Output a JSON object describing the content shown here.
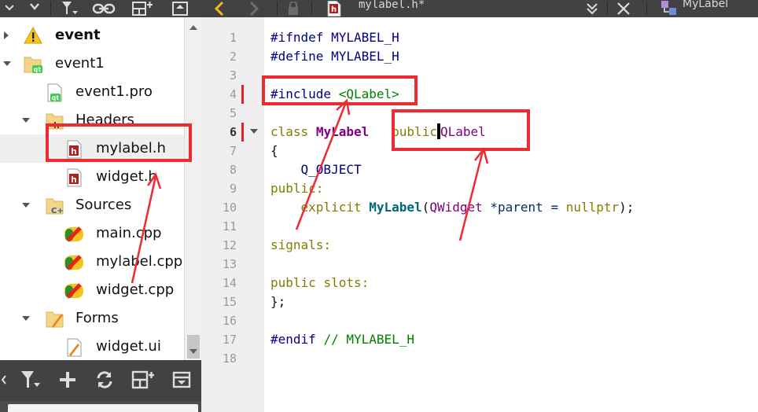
{
  "editor": {
    "file_title": "mylabel.h*",
    "class_selector": "MyLabel",
    "line_numbers": [
      "1",
      "2",
      "3",
      "4",
      "5",
      "6",
      "7",
      "8",
      "9",
      "10",
      "11",
      "12",
      "13",
      "14",
      "15",
      "16",
      "17",
      "18"
    ],
    "current_line": "6",
    "code": {
      "l1_directive": "#ifndef",
      "l1_symbol": "MYLABEL_H",
      "l2_directive": "#define",
      "l2_symbol": "MYLABEL_H",
      "l4_directive": "#include",
      "l4_header": "<QLabel>",
      "l6_class_kw": "class",
      "l6_class_name": "MyLabel",
      "l6_public": "public",
      "l6_base": "QLabel",
      "l7_brace": "{",
      "l8_macro": "Q_OBJECT",
      "l9_access": "public:",
      "l10_explicit": "explicit",
      "l10_ctor": "MyLabel",
      "l10_paren_open": "(",
      "l10_param_type": "QWidget",
      "l10_param": " *parent = ",
      "l10_default": "nullptr",
      "l10_end": ");",
      "l12_signals": "signals:",
      "l14_public": "public",
      "l14_slots": "slots:",
      "l15_close": "};",
      "l17_directive": "#endif",
      "l17_comment": "// MYLABEL_H"
    }
  },
  "tree": {
    "items": [
      {
        "label": "event",
        "icon": "warning-icon",
        "state": "collapsed"
      },
      {
        "label": "event1",
        "icon": "qt-project-folder-icon",
        "state": "expanded"
      },
      {
        "label": "event1.pro",
        "icon": "qt-pro-file-icon"
      },
      {
        "label": "Headers",
        "icon": "headers-folder-icon",
        "state": "expanded"
      },
      {
        "label": "mylabel.h",
        "icon": "header-file-icon",
        "selected": true
      },
      {
        "label": "widget.h",
        "icon": "header-file-icon"
      },
      {
        "label": "Sources",
        "icon": "sources-folder-icon",
        "state": "expanded"
      },
      {
        "label": "main.cpp",
        "icon": "cpp-file-icon"
      },
      {
        "label": "mylabel.cpp",
        "icon": "cpp-file-icon"
      },
      {
        "label": "widget.cpp",
        "icon": "cpp-file-icon"
      },
      {
        "label": "Forms",
        "icon": "forms-folder-icon",
        "state": "expanded"
      },
      {
        "label": "widget.ui",
        "icon": "ui-file-icon"
      }
    ]
  },
  "colors": {
    "toolbar_bg": "#404244",
    "annotation_red": "#ee2a33",
    "selection_bg": "#efefef",
    "keyword": "#808000",
    "preprocessor": "#000080",
    "class_name": "#800080",
    "comment": "#008000"
  }
}
